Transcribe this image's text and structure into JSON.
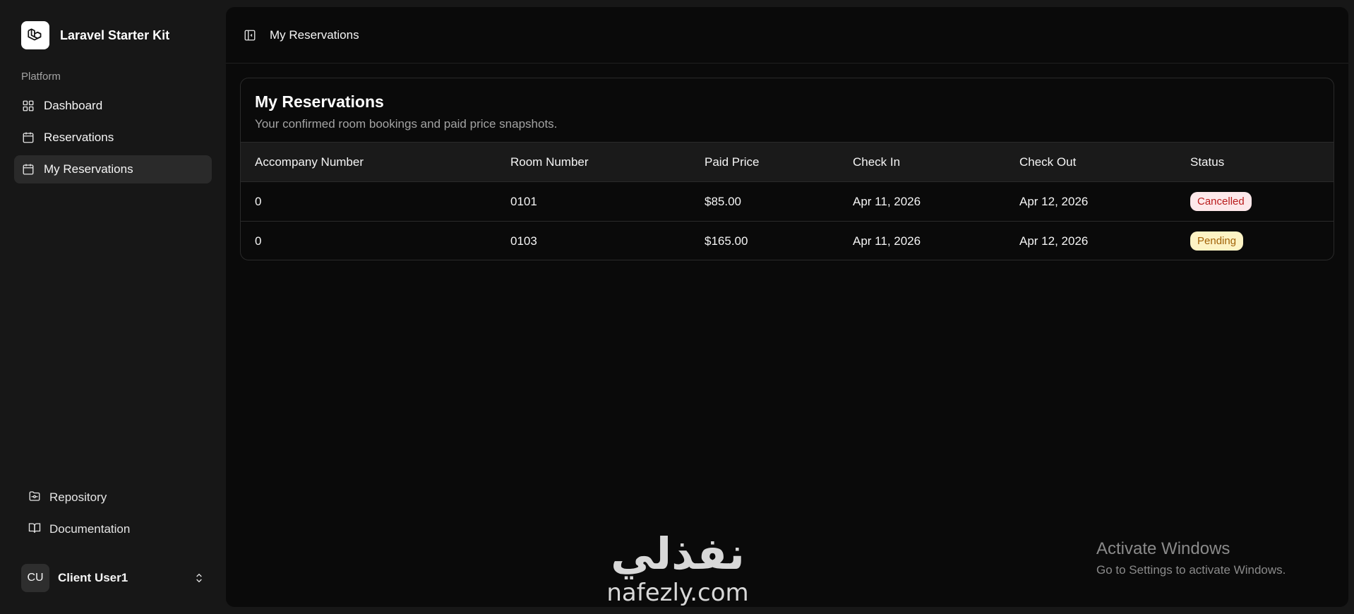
{
  "sidebar": {
    "brand": "Laravel Starter Kit",
    "group_label": "Platform",
    "nav": [
      {
        "label": "Dashboard",
        "icon": "layout-grid-icon"
      },
      {
        "label": "Reservations",
        "icon": "calendar-icon"
      },
      {
        "label": "My Reservations",
        "icon": "calendar-icon",
        "active": true
      }
    ],
    "links": [
      {
        "label": "Repository",
        "icon": "folder-git-icon"
      },
      {
        "label": "Documentation",
        "icon": "book-open-icon"
      }
    ],
    "user": {
      "initials": "CU",
      "name": "Client User1",
      "icon": "chevrons-up-down-icon"
    }
  },
  "header": {
    "breadcrumb": "My Reservations",
    "toggle_icon": "panel-left-icon"
  },
  "card": {
    "title": "My Reservations",
    "subtitle": "Your confirmed room bookings and paid price snapshots.",
    "columns": [
      "Accompany Number",
      "Room Number",
      "Paid Price",
      "Check In",
      "Check Out",
      "Status"
    ],
    "rows": [
      {
        "accompany": "0",
        "room": "0101",
        "price": "$85.00",
        "check_in": "Apr 11, 2026",
        "check_out": "Apr 12, 2026",
        "status": "Cancelled"
      },
      {
        "accompany": "0",
        "room": "0103",
        "price": "$165.00",
        "check_in": "Apr 11, 2026",
        "check_out": "Apr 12, 2026",
        "status": "Pending"
      }
    ]
  },
  "status_colors": {
    "Cancelled": {
      "bg": "#fde8ea",
      "fg": "#b91c1c"
    },
    "Pending": {
      "bg": "#fdf3c4",
      "fg": "#a16207"
    }
  },
  "watermark": {
    "arabic": "نفذلي",
    "latin": "nafezly.com"
  },
  "activation": {
    "title": "Activate Windows",
    "subtitle": "Go to Settings to activate Windows."
  }
}
